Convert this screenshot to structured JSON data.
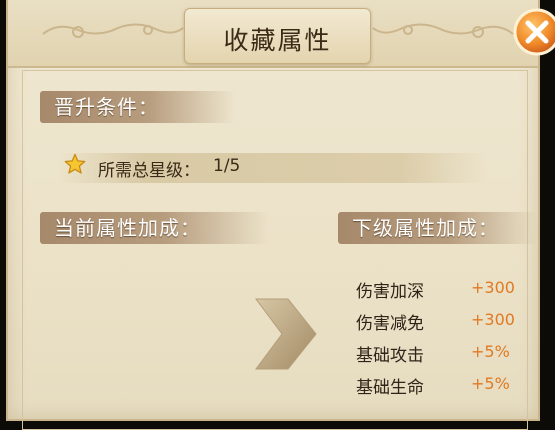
{
  "dialog": {
    "title": "收藏属性",
    "close_icon": "close-icon"
  },
  "requirements": {
    "header": "晋升条件：",
    "star_icon": "star-icon",
    "label": "所需总星级：",
    "value": "1/5"
  },
  "current_bonus": {
    "header": "当前属性加成："
  },
  "next_bonus": {
    "header": "下级属性加成：",
    "stats": [
      {
        "name": "伤害加深",
        "value": "+300"
      },
      {
        "name": "伤害减免",
        "value": "+300"
      },
      {
        "name": "基础攻击",
        "value": "+5%"
      },
      {
        "name": "基础生命",
        "value": "+5%"
      }
    ]
  },
  "colors": {
    "panel_bg": "#ebe2c8",
    "section_header": "#a6896a",
    "stat_value": "#e07a24",
    "close_button": "#ef8a2a"
  }
}
